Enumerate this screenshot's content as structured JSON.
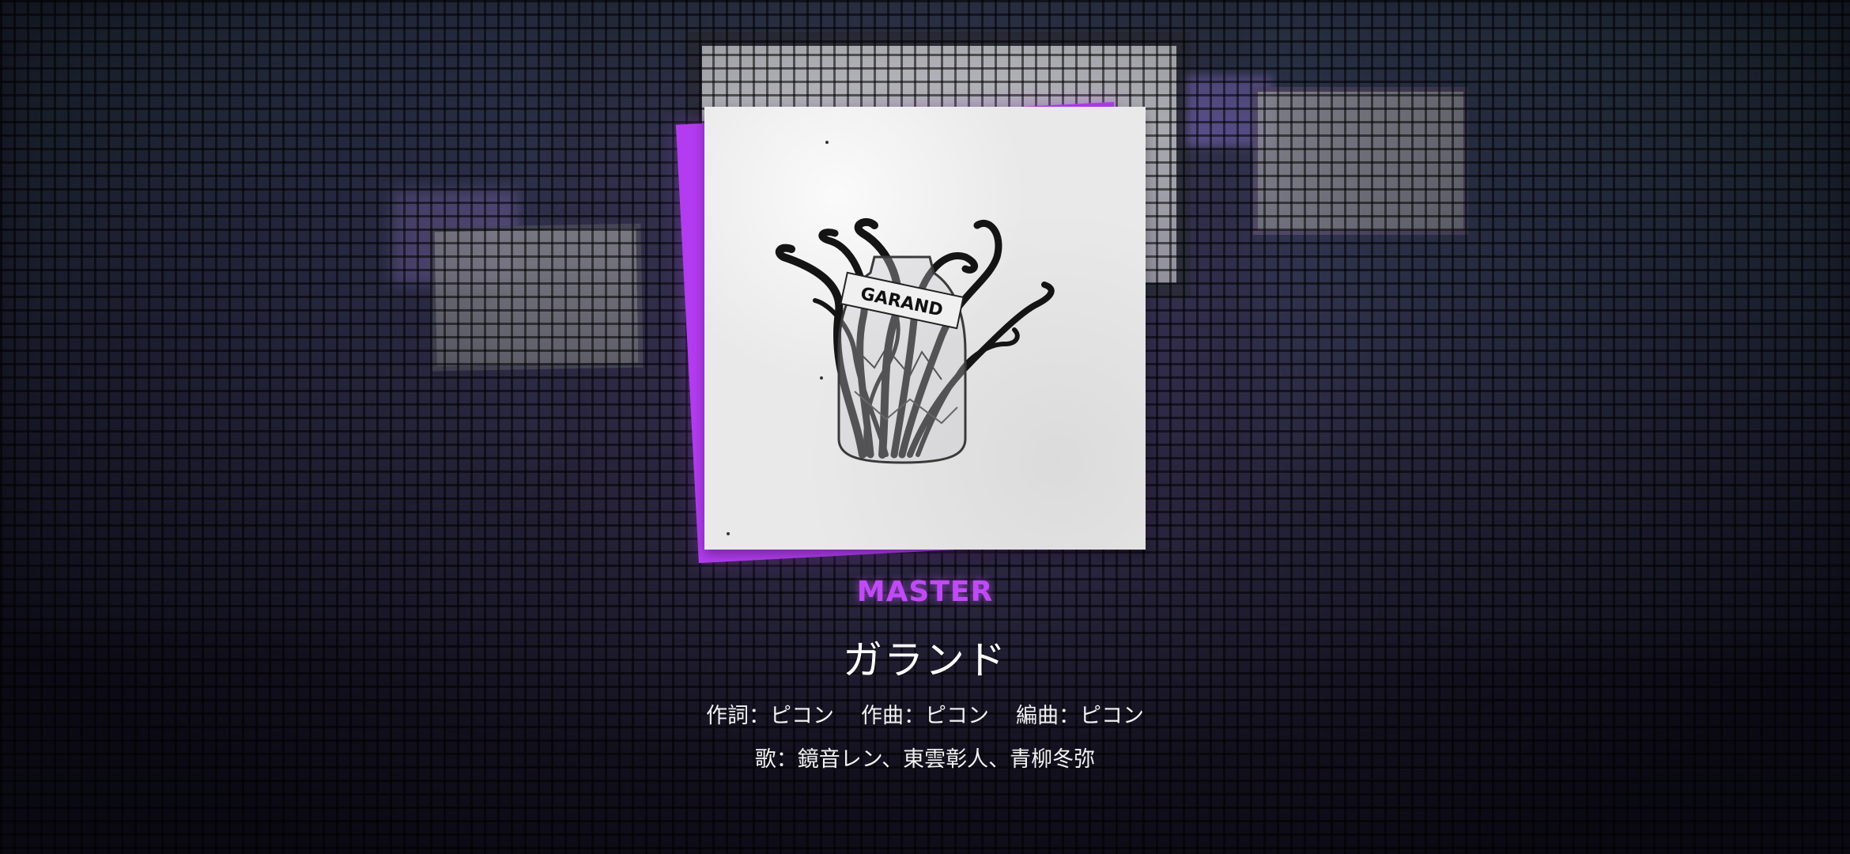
{
  "difficulty": {
    "label": "MASTER",
    "color": "#c04af5"
  },
  "song": {
    "title": "ガランド",
    "jacket_text": "GARAND",
    "jacket_accent_color": "#b33cf0"
  },
  "credits": {
    "lyrics": "作詞：ピコン",
    "composition": "作曲：ピコン",
    "arrangement": "編曲：ピコン",
    "vocals": "歌：鏡音レン、東雲彰人、青柳冬弥"
  }
}
